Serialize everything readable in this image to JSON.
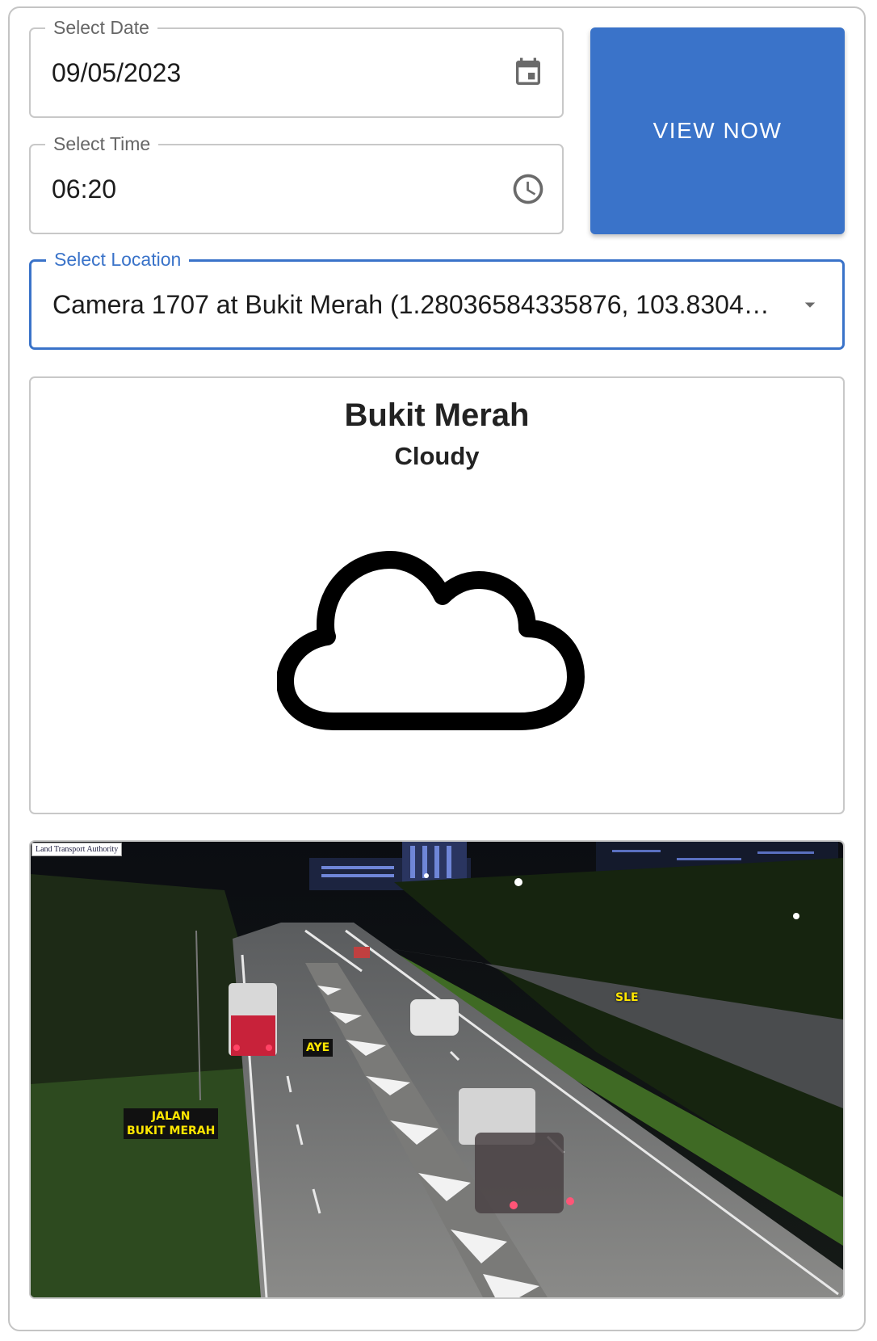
{
  "form": {
    "date": {
      "label": "Select Date",
      "value": "09/05/2023",
      "icon": "calendar-icon"
    },
    "time": {
      "label": "Select Time",
      "value": "06:20",
      "icon": "clock-icon"
    },
    "location": {
      "label": "Select Location",
      "value": "Camera 1707 at Bukit Merah (1.28036584335876, 103.830451...",
      "icon": "dropdown-arrow-icon"
    },
    "view_button": "VIEW NOW"
  },
  "weather": {
    "area": "Bukit Merah",
    "condition": "Cloudy",
    "icon": "cloud-icon"
  },
  "camera": {
    "watermark": "Land Transport Authority",
    "labels": {
      "aye": "AYE",
      "sle": "SLE",
      "jalan_line1": "JALAN",
      "jalan_line2": "BUKIT MERAH"
    }
  },
  "colors": {
    "accent": "#3a73c9",
    "border": "#c8c8c8",
    "road_label_bg": "#111111",
    "road_label_fg": "#ffe600"
  }
}
